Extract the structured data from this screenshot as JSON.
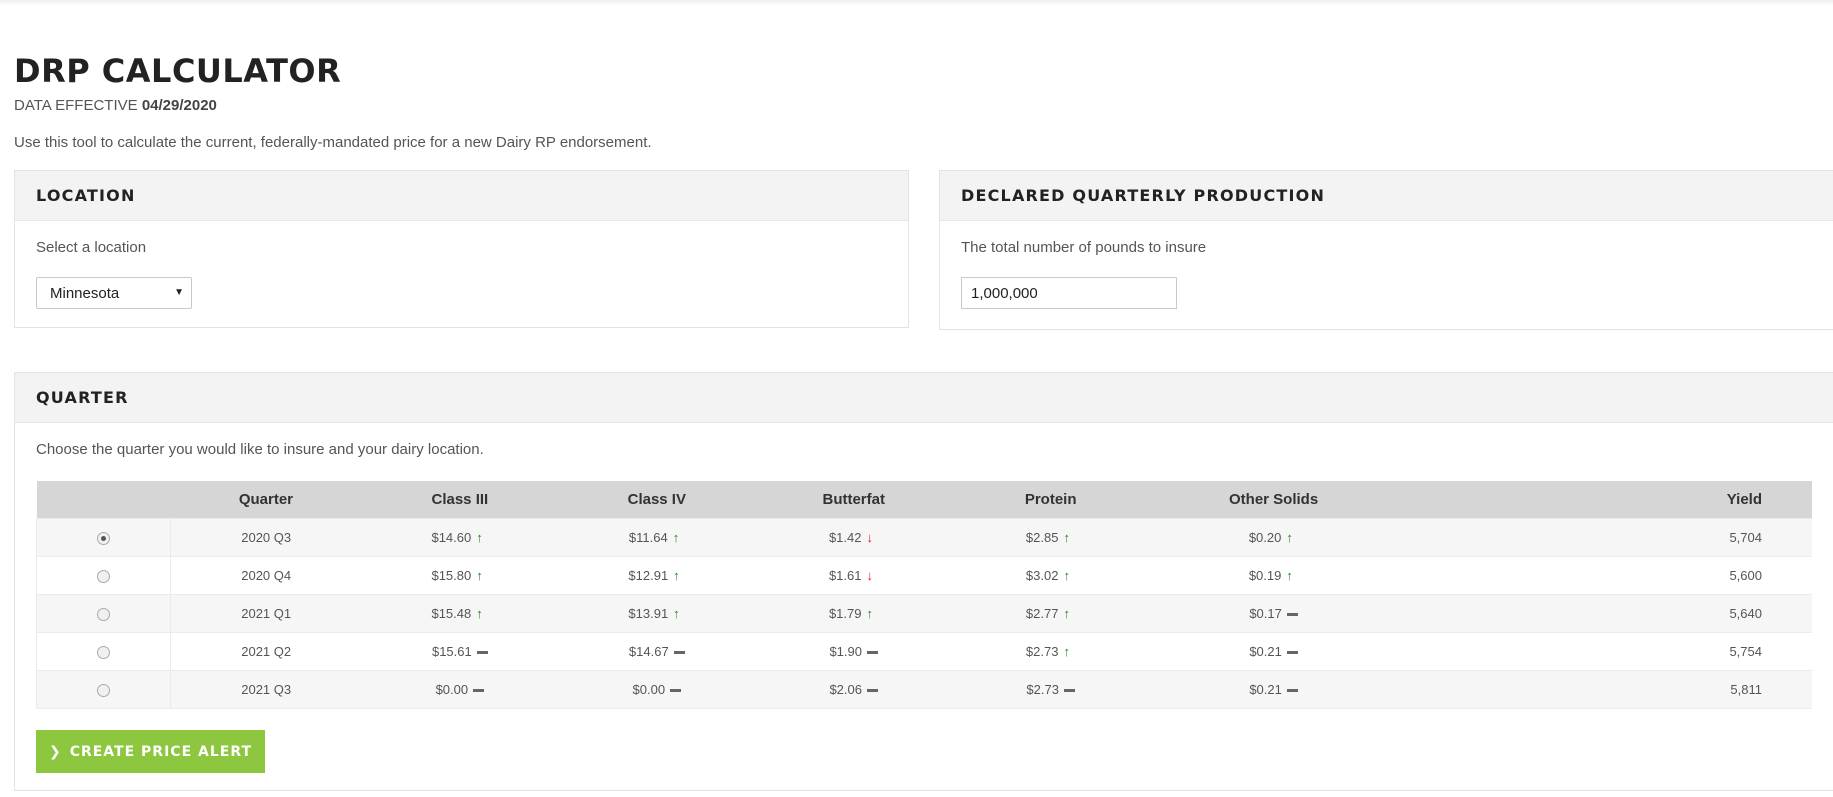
{
  "header": {
    "title": "DRP CALCULATOR",
    "effective_prefix": "DATA EFFECTIVE",
    "effective_date": "04/29/2020",
    "intro": "Use this tool to calculate the current, federally-mandated price for a new Dairy RP endorsement."
  },
  "location": {
    "heading": "LOCATION",
    "label": "Select a location",
    "selected": "Minnesota"
  },
  "production": {
    "heading": "DECLARED QUARTERLY PRODUCTION",
    "label": "The total number of pounds to insure",
    "value": "1,000,000"
  },
  "quarter": {
    "heading": "QUARTER",
    "label": "Choose the quarter you would like to insure and your dairy location.",
    "columns": [
      "",
      "Quarter",
      "Class III",
      "Class IV",
      "Butterfat",
      "Protein",
      "Other Solids",
      "Yield"
    ],
    "rows": [
      {
        "selected": true,
        "quarter": "2020 Q3",
        "class3": "$14.60",
        "class3_trend": "up",
        "class4": "$11.64",
        "class4_trend": "up",
        "butterfat": "$1.42",
        "butterfat_trend": "down",
        "protein": "$2.85",
        "protein_trend": "up",
        "other_solids": "$0.20",
        "other_solids_trend": "up",
        "yield": "5,704"
      },
      {
        "selected": false,
        "quarter": "2020 Q4",
        "class3": "$15.80",
        "class3_trend": "up",
        "class4": "$12.91",
        "class4_trend": "up",
        "butterfat": "$1.61",
        "butterfat_trend": "down",
        "protein": "$3.02",
        "protein_trend": "up",
        "other_solids": "$0.19",
        "other_solids_trend": "up",
        "yield": "5,600"
      },
      {
        "selected": false,
        "quarter": "2021 Q1",
        "class3": "$15.48",
        "class3_trend": "up",
        "class4": "$13.91",
        "class4_trend": "up",
        "butterfat": "$1.79",
        "butterfat_trend": "up",
        "protein": "$2.77",
        "protein_trend": "up",
        "other_solids": "$0.17",
        "other_solids_trend": "flat",
        "yield": "5,640"
      },
      {
        "selected": false,
        "quarter": "2021 Q2",
        "class3": "$15.61",
        "class3_trend": "flat",
        "class4": "$14.67",
        "class4_trend": "flat",
        "butterfat": "$1.90",
        "butterfat_trend": "flat",
        "protein": "$2.73",
        "protein_trend": "up",
        "other_solids": "$0.21",
        "other_solids_trend": "flat",
        "yield": "5,754"
      },
      {
        "selected": false,
        "quarter": "2021 Q3",
        "class3": "$0.00",
        "class3_trend": "flat",
        "class4": "$0.00",
        "class4_trend": "flat",
        "butterfat": "$2.06",
        "butterfat_trend": "flat",
        "protein": "$2.73",
        "protein_trend": "flat",
        "other_solids": "$0.21",
        "other_solids_trend": "flat",
        "yield": "5,811"
      }
    ],
    "alert_button": "CREATE PRICE ALERT"
  },
  "colors": {
    "trend_up": "#1f8a1f",
    "trend_down": "#e01a1a",
    "trend_flat": "#666666",
    "button": "#8dc63f"
  },
  "icons": {
    "up": "arrow-up-icon",
    "down": "arrow-down-icon",
    "flat": "dash-icon",
    "button": "chevron-right-icon",
    "select": "caret-down-icon"
  }
}
